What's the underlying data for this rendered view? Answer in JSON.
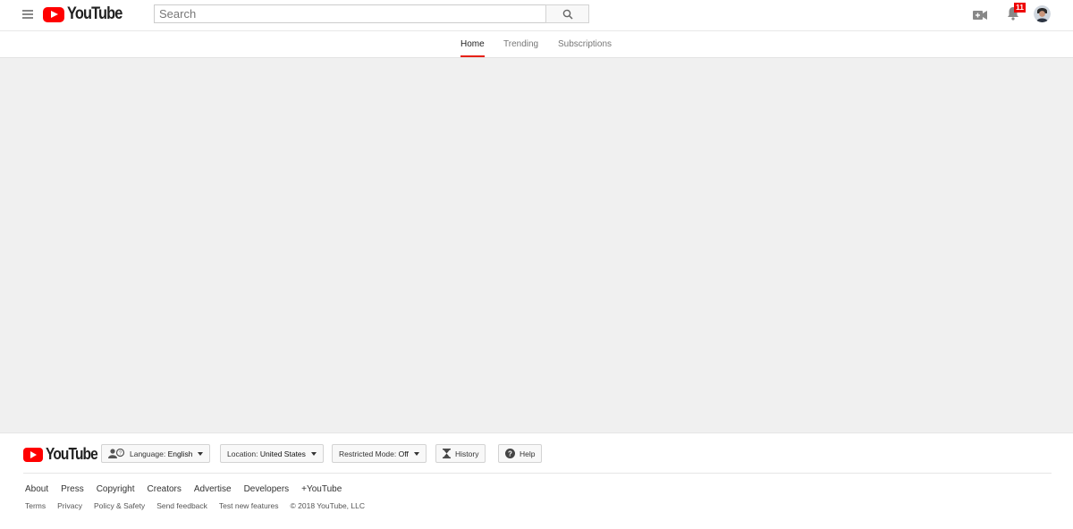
{
  "masthead": {
    "logo_text": "YouTube",
    "search": {
      "placeholder": "Search",
      "value": ""
    },
    "notifications_count": "11"
  },
  "tabs": [
    {
      "label": "Home",
      "active": true
    },
    {
      "label": "Trending",
      "active": false
    },
    {
      "label": "Subscriptions",
      "active": false
    }
  ],
  "footer": {
    "logo_text": "YouTube",
    "language": {
      "label": "Language:",
      "value": "English"
    },
    "location": {
      "label": "Location:",
      "value": "United States"
    },
    "restricted": {
      "label": "Restricted Mode:",
      "value": "Off"
    },
    "history_label": "History",
    "help_label": "Help",
    "primary_links": [
      "About",
      "Press",
      "Copyright",
      "Creators",
      "Advertise",
      "Developers",
      "+YouTube"
    ],
    "secondary_links": [
      "Terms",
      "Privacy",
      "Policy & Safety",
      "Send feedback",
      "Test new features"
    ],
    "copyright": "© 2018 YouTube, LLC"
  },
  "colors": {
    "brand_red": "#ff0000",
    "tab_underline": "#e62117",
    "main_background": "#f0f0f0"
  },
  "icons": [
    "menu-icon",
    "youtube-logo-icon",
    "search-icon",
    "video-camera-icon",
    "bell-icon",
    "avatar",
    "language-icon",
    "hourglass-icon",
    "help-icon"
  ]
}
